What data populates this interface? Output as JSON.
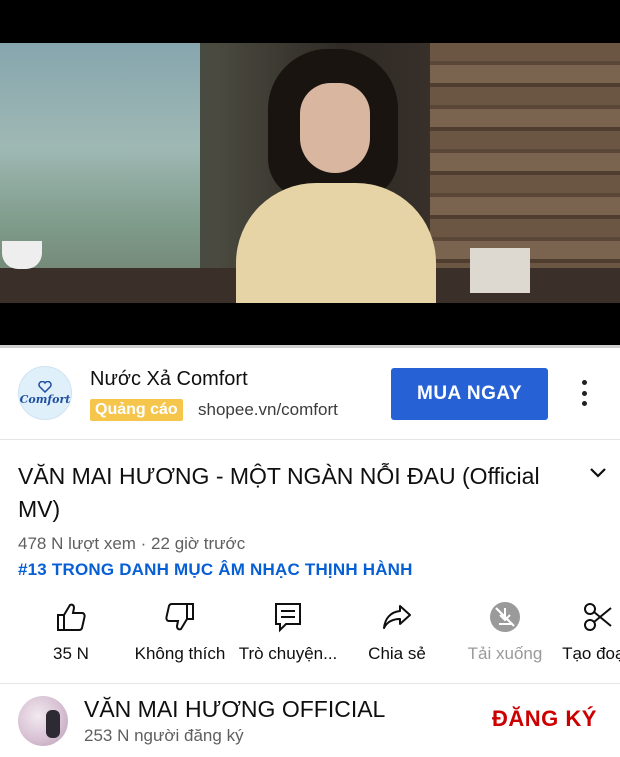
{
  "ad": {
    "title": "Nước Xả Comfort",
    "badge": "Quảng cáo",
    "url": "shopee.vn/comfort",
    "cta": "MUA NGAY",
    "logo_text": "Comfort",
    "more_icon": "more-vert-icon"
  },
  "video": {
    "title": "VĂN MAI HƯƠNG - MỘT NGÀN NỖI ĐAU (Official MV)",
    "meta": "478 N lượt xem · 22 giờ trước",
    "trending": "#13 TRONG DANH MỤC ÂM NHẠC THỊNH HÀNH",
    "expand_icon": "chevron-down-icon"
  },
  "actions": [
    {
      "label": "35 N",
      "icon": "thumbs-up-icon",
      "enabled": true
    },
    {
      "label": "Không thích",
      "icon": "thumbs-down-icon",
      "enabled": true
    },
    {
      "label": "Trò chuyện...",
      "icon": "comment-icon",
      "enabled": true
    },
    {
      "label": "Chia sẻ",
      "icon": "share-icon",
      "enabled": true
    },
    {
      "label": "Tải xuống",
      "icon": "download-off-icon",
      "enabled": false
    },
    {
      "label": "Tạo đoạn",
      "icon": "scissors-icon",
      "enabled": true
    }
  ],
  "channel": {
    "name": "VĂN MAI HƯƠNG OFFICIAL",
    "subscribers": "253 N người đăng ký",
    "subscribe": "ĐĂNG KÝ"
  },
  "colors": {
    "cta_blue": "#2662d6",
    "badge_yellow": "#f6c64c",
    "link_blue": "#065fd4",
    "subscribe_red": "#cc0000"
  }
}
